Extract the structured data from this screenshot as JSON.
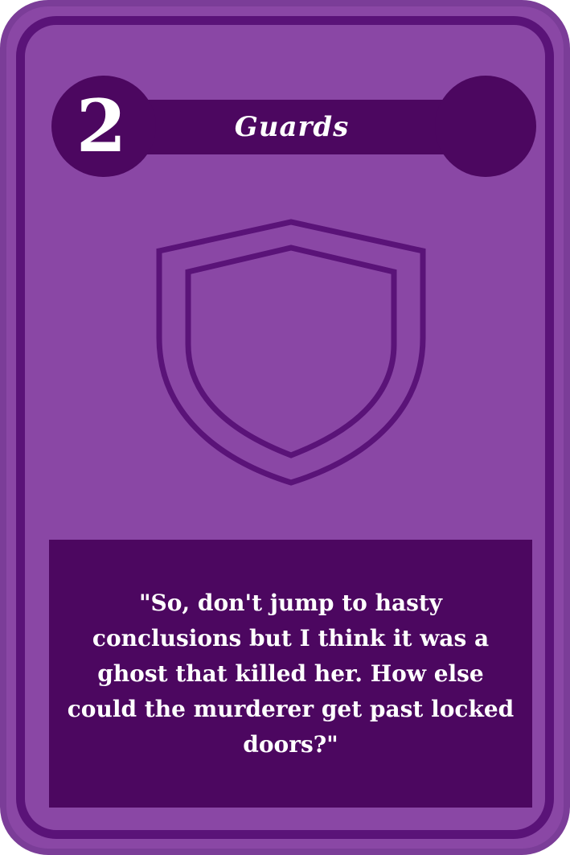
{
  "card": {
    "number": "2",
    "title": "Guards",
    "emblem": "shield-icon",
    "quote": "\"So, don't jump to hasty conclusions but I think it was a ghost that killed her. How else could the murderer get past locked doors?\""
  },
  "colors": {
    "card_fill": "#8a47a5",
    "card_outer": "#7b3d98",
    "frame": "#5a1378",
    "dark_panel": "#4c0760",
    "text": "#ffffff"
  }
}
